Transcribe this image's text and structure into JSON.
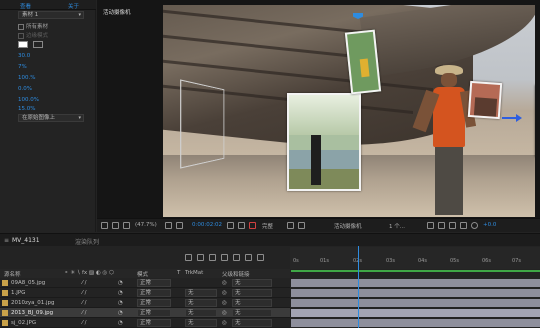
{
  "left_panel": {
    "tab_a": "查看",
    "tab_b": "关于",
    "dropdown_value": "素材 1",
    "option_checked": "所有素材",
    "option_disabled": "边缘模式",
    "values": [
      "30.0",
      "7%",
      "100.%",
      "0.0%",
      "100.0%",
      "15.0%"
    ],
    "bottom_dropdown": "在原始图像上"
  },
  "viewer": {
    "label": "活动摄像机",
    "toolbar": {
      "zoom": "(47.7%)",
      "timecode": "0:00:02:02",
      "quality": "完整",
      "camera": "活动摄像机",
      "views": "1 个...",
      "exposure": "+0.0"
    }
  },
  "timeline": {
    "tab_comp": "MV_4131",
    "tab_render": "渲染队列",
    "tab_close": "≡",
    "ruler_ticks": [
      "0s",
      "01s",
      "02s",
      "03s",
      "04s",
      "05s",
      "06s",
      "07s"
    ],
    "header": {
      "name": "源名称",
      "mode": "模式",
      "t": "T",
      "trkmat": "TrkMat",
      "parent": "父级和链接"
    },
    "layers": [
      {
        "name": "09A8_05.jpg",
        "mode": "正常",
        "trkmat": "",
        "parent": "无",
        "selected": false
      },
      {
        "name": "1.JPG",
        "mode": "正常",
        "trkmat": "无",
        "parent": "无",
        "selected": false
      },
      {
        "name": "2010zya_01.jpg",
        "mode": "正常",
        "trkmat": "无",
        "parent": "无",
        "selected": false
      },
      {
        "name": "2013_BJ_09.jpg",
        "mode": "正常",
        "trkmat": "无",
        "parent": "无",
        "selected": true
      },
      {
        "name": "sj_02.JPG",
        "mode": "正常",
        "trkmat": "无",
        "parent": "无",
        "selected": false
      }
    ]
  },
  "colors": {
    "accent": "#2e8ce0",
    "panel": "#232323",
    "layer_bar": "#8e8f9c"
  }
}
